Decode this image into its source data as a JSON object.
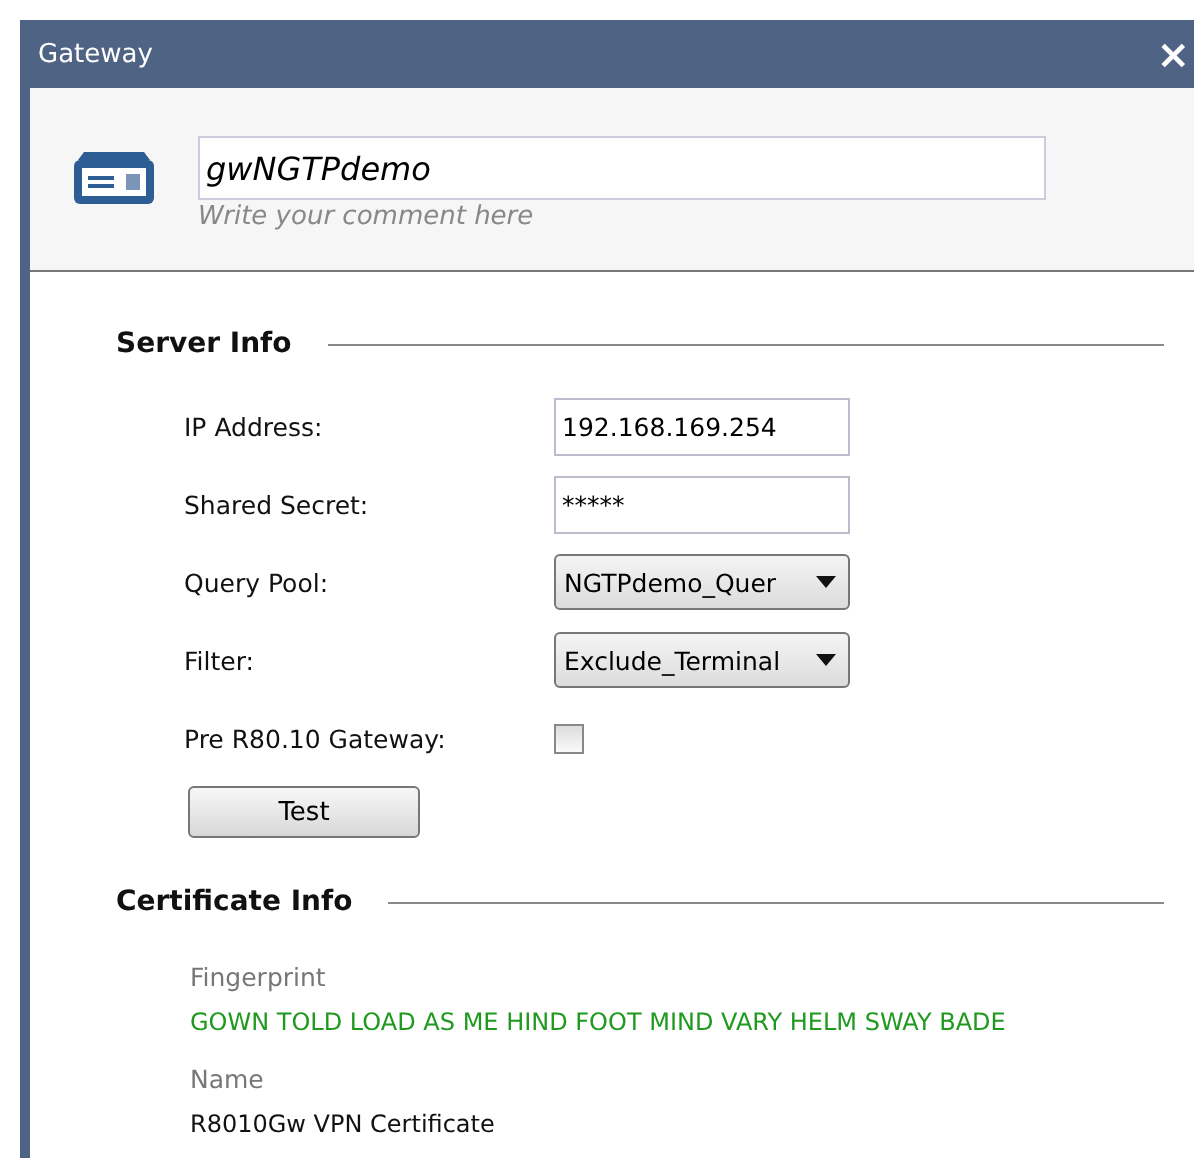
{
  "window": {
    "title": "Gateway",
    "close": "×"
  },
  "header": {
    "name": "gwNGTPdemo",
    "comment_placeholder": "Write your comment here"
  },
  "server_info": {
    "title": "Server Info",
    "fields": [
      {
        "kind": "text",
        "label": "IP Address:",
        "value": "192.168.169.254"
      },
      {
        "kind": "text",
        "label": "Shared Secret:",
        "value": "*****"
      },
      {
        "kind": "dropdown",
        "label": "Query Pool:",
        "value": "NGTPdemo_Quer"
      },
      {
        "kind": "dropdown",
        "label": "Filter:",
        "value": "Exclude_Terminal"
      },
      {
        "kind": "checkbox",
        "label": "Pre R80.10 Gateway:",
        "checked": false
      }
    ],
    "button": "Test"
  },
  "certificate_info": {
    "title": "Certificate Info",
    "items": [
      {
        "label": "Fingerprint",
        "value": "GOWN TOLD LOAD AS ME HIND FOOT MIND VARY HELM SWAY BADE",
        "highlight": true
      },
      {
        "label": "Name",
        "value": "R8010Gw VPN Certificate",
        "highlight": false
      }
    ]
  }
}
